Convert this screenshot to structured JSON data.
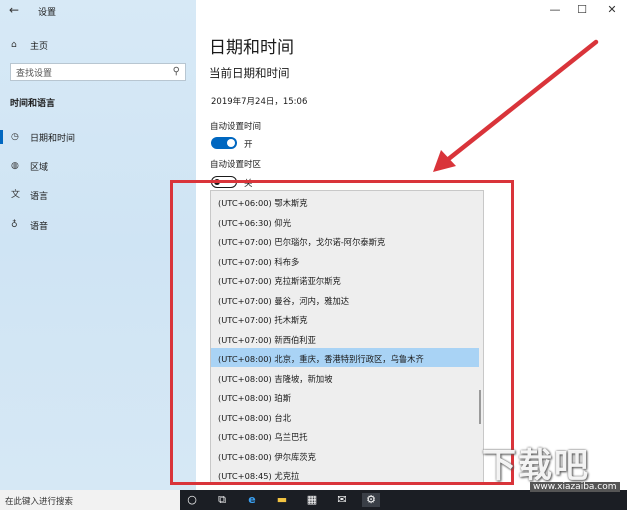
{
  "window": {
    "title": "设置",
    "minimize_glyph": "—",
    "maximize_glyph": "☐",
    "close_glyph": "✕",
    "back_glyph": "←"
  },
  "sidebar": {
    "home_label": "主页",
    "search_placeholder": "查找设置",
    "section_title": "时间和语言",
    "items": [
      {
        "label": "日期和时间",
        "icon": "clock-icon"
      },
      {
        "label": "区域",
        "icon": "globe-icon"
      },
      {
        "label": "语言",
        "icon": "language-icon"
      },
      {
        "label": "语音",
        "icon": "microphone-icon"
      }
    ]
  },
  "main": {
    "page_title": "日期和时间",
    "current_label": "当前日期和时间",
    "current_value": "2019年7月24日，15:06",
    "auto_time_label": "自动设置时间",
    "auto_time_state": "开",
    "auto_zone_label": "自动设置时区",
    "auto_zone_state": "关"
  },
  "timezone_options": [
    "(UTC+06:00) 鄂木斯克",
    "(UTC+06:30) 仰光",
    "(UTC+07:00) 巴尔瑙尔，戈尔诺-阿尔泰斯克",
    "(UTC+07:00) 科布多",
    "(UTC+07:00) 克拉斯诺亚尔斯克",
    "(UTC+07:00) 曼谷，河内，雅加达",
    "(UTC+07:00) 托木斯克",
    "(UTC+07:00) 新西伯利亚",
    "(UTC+08:00) 北京，重庆，香港特别行政区，乌鲁木齐",
    "(UTC+08:00) 吉隆坡，新加坡",
    "(UTC+08:00) 珀斯",
    "(UTC+08:00) 台北",
    "(UTC+08:00) 乌兰巴托",
    "(UTC+08:00) 伊尔库茨克",
    "(UTC+08:45) 尤克拉"
  ],
  "selected_timezone": "(UTC+08:00) 北京，重庆，香港特别行政区，乌鲁木齐",
  "taskbar": {
    "search_placeholder": "在此键入进行搜索",
    "cortana_glyph": "○",
    "taskview_glyph": "⧉",
    "edge_glyph": "e",
    "explorer_glyph": "▬",
    "store_glyph": "▦",
    "mail_glyph": "✉",
    "settings_glyph": "⚙"
  },
  "watermark": {
    "logo_text": "下载吧",
    "sub_text": "www.xiazaiba.com"
  },
  "colors": {
    "accent": "#0067c0",
    "selected_row": "#a9d3f5",
    "highlight_box": "#d9343a",
    "arrow": "#d9343a"
  }
}
